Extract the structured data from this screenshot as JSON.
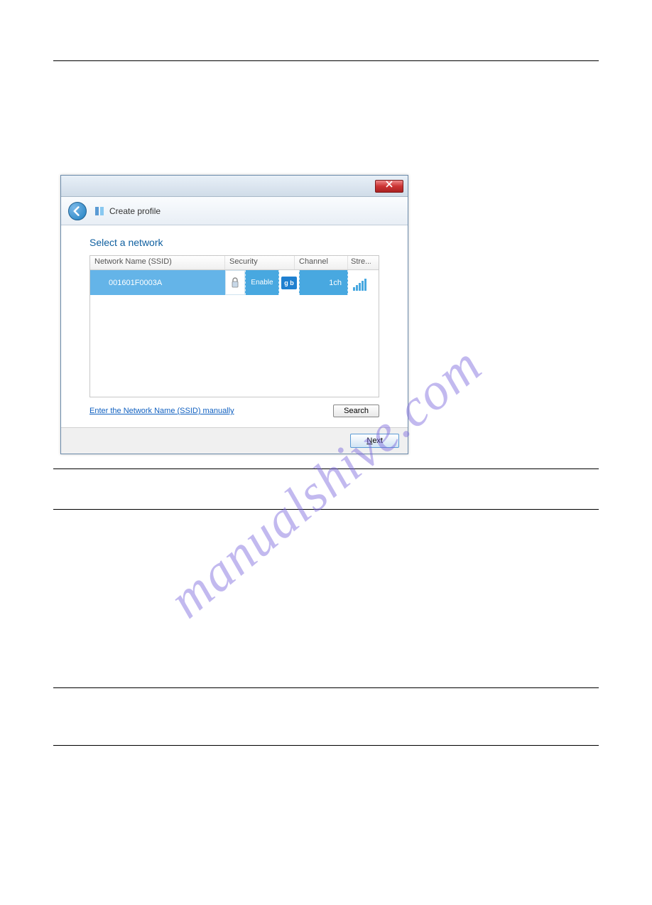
{
  "watermark": "manualshive.com",
  "dialog": {
    "title": "Create profile",
    "section_title": "Select a network",
    "columns": {
      "name": "Network Name (SSID)",
      "security": "Security",
      "channel": "Channel",
      "strength": "Stre..."
    },
    "row": {
      "ssid": "001601F0003A",
      "security_status": "Enable",
      "mode": "g b",
      "channel": "1ch"
    },
    "manual_link": "Enter the Network Name (SSID) manually",
    "search_btn": "Search",
    "next_btn_letter": "N",
    "next_btn_rest": "ext"
  }
}
